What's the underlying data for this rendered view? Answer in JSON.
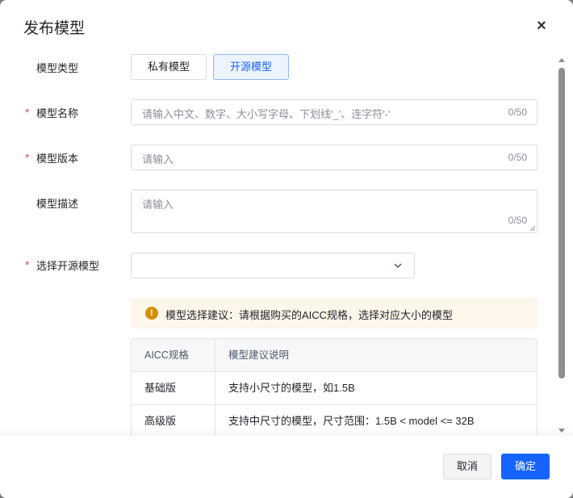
{
  "dialog": {
    "title": "发布模型",
    "close_label": "×"
  },
  "form": {
    "model_type": {
      "label": "模型类型",
      "options": [
        "私有模型",
        "开源模型"
      ],
      "selected": "开源模型"
    },
    "model_name": {
      "label": "模型名称",
      "required_mark": "*",
      "placeholder": "请输入中文、数字、大小写字母、下划线'_'、连字符'-'",
      "counter": "0/50"
    },
    "model_version": {
      "label": "模型版本",
      "required_mark": "*",
      "placeholder": "请输入",
      "counter": "0/50"
    },
    "model_desc": {
      "label": "模型描述",
      "placeholder": "请输入",
      "counter": "0/50"
    },
    "open_source_model": {
      "label": "选择开源模型",
      "required_mark": "*",
      "value": ""
    }
  },
  "alert": {
    "icon": "!",
    "text": "模型选择建议：请根据购买的AICC规格，选择对应大小的模型"
  },
  "table": {
    "headers": [
      "AICC规格",
      "模型建议说明"
    ],
    "rows": [
      [
        "基础版",
        "支持小尺寸的模型，如1.5B"
      ],
      [
        "高级版",
        "支持中尺寸的模型，尺寸范围：1.5B < model <= 32B"
      ]
    ]
  },
  "footer": {
    "cancel_label": "取消",
    "ok_label": "确定"
  },
  "colors": {
    "primary": "#1664ff",
    "required": "#e34d59",
    "warning": "#d4900a"
  }
}
